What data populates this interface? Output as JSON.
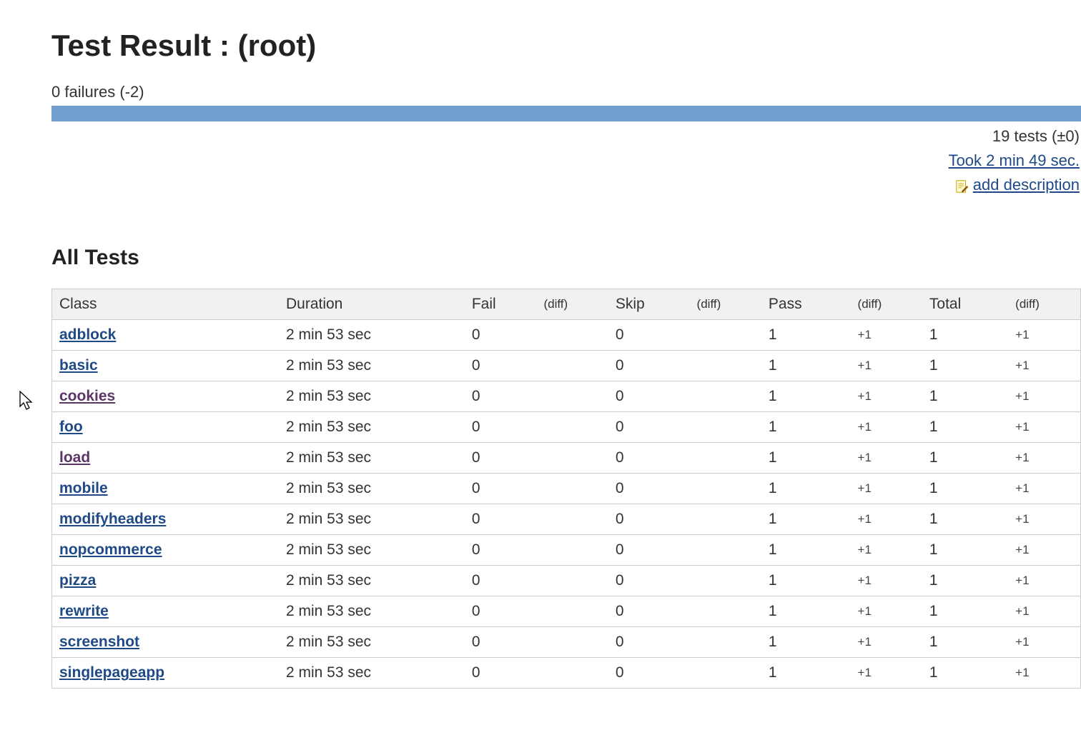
{
  "header": {
    "title": "Test Result : (root)",
    "failures_line": "0 failures (-2)"
  },
  "meta": {
    "tests_line": "19 tests (±0)",
    "took_line": "Took 2 min 49 sec.",
    "add_desc_label": "add description"
  },
  "section": {
    "all_tests_title": "All Tests"
  },
  "table": {
    "headers": {
      "class": "Class",
      "duration": "Duration",
      "fail": "Fail",
      "fail_diff": "(diff)",
      "skip": "Skip",
      "skip_diff": "(diff)",
      "pass": "Pass",
      "pass_diff": "(diff)",
      "total": "Total",
      "total_diff": "(diff)"
    },
    "rows": [
      {
        "class": "adblock",
        "visited": false,
        "duration": "2 min 53 sec",
        "fail": "0",
        "fail_diff": "",
        "skip": "0",
        "skip_diff": "",
        "pass": "1",
        "pass_diff": "+1",
        "total": "1",
        "total_diff": "+1"
      },
      {
        "class": "basic",
        "visited": false,
        "duration": "2 min 53 sec",
        "fail": "0",
        "fail_diff": "",
        "skip": "0",
        "skip_diff": "",
        "pass": "1",
        "pass_diff": "+1",
        "total": "1",
        "total_diff": "+1"
      },
      {
        "class": "cookies",
        "visited": true,
        "duration": "2 min 53 sec",
        "fail": "0",
        "fail_diff": "",
        "skip": "0",
        "skip_diff": "",
        "pass": "1",
        "pass_diff": "+1",
        "total": "1",
        "total_diff": "+1"
      },
      {
        "class": "foo",
        "visited": false,
        "duration": "2 min 53 sec",
        "fail": "0",
        "fail_diff": "",
        "skip": "0",
        "skip_diff": "",
        "pass": "1",
        "pass_diff": "+1",
        "total": "1",
        "total_diff": "+1"
      },
      {
        "class": "load",
        "visited": true,
        "duration": "2 min 53 sec",
        "fail": "0",
        "fail_diff": "",
        "skip": "0",
        "skip_diff": "",
        "pass": "1",
        "pass_diff": "+1",
        "total": "1",
        "total_diff": "+1"
      },
      {
        "class": "mobile",
        "visited": false,
        "duration": "2 min 53 sec",
        "fail": "0",
        "fail_diff": "",
        "skip": "0",
        "skip_diff": "",
        "pass": "1",
        "pass_diff": "+1",
        "total": "1",
        "total_diff": "+1"
      },
      {
        "class": "modifyheaders",
        "visited": false,
        "duration": "2 min 53 sec",
        "fail": "0",
        "fail_diff": "",
        "skip": "0",
        "skip_diff": "",
        "pass": "1",
        "pass_diff": "+1",
        "total": "1",
        "total_diff": "+1"
      },
      {
        "class": "nopcommerce",
        "visited": false,
        "duration": "2 min 53 sec",
        "fail": "0",
        "fail_diff": "",
        "skip": "0",
        "skip_diff": "",
        "pass": "1",
        "pass_diff": "+1",
        "total": "1",
        "total_diff": "+1"
      },
      {
        "class": "pizza",
        "visited": false,
        "duration": "2 min 53 sec",
        "fail": "0",
        "fail_diff": "",
        "skip": "0",
        "skip_diff": "",
        "pass": "1",
        "pass_diff": "+1",
        "total": "1",
        "total_diff": "+1"
      },
      {
        "class": "rewrite",
        "visited": false,
        "duration": "2 min 53 sec",
        "fail": "0",
        "fail_diff": "",
        "skip": "0",
        "skip_diff": "",
        "pass": "1",
        "pass_diff": "+1",
        "total": "1",
        "total_diff": "+1"
      },
      {
        "class": "screenshot",
        "visited": false,
        "duration": "2 min 53 sec",
        "fail": "0",
        "fail_diff": "",
        "skip": "0",
        "skip_diff": "",
        "pass": "1",
        "pass_diff": "+1",
        "total": "1",
        "total_diff": "+1"
      },
      {
        "class": "singlepageapp",
        "visited": false,
        "duration": "2 min 53 sec",
        "fail": "0",
        "fail_diff": "",
        "skip": "0",
        "skip_diff": "",
        "pass": "1",
        "pass_diff": "+1",
        "total": "1",
        "total_diff": "+1"
      }
    ]
  }
}
